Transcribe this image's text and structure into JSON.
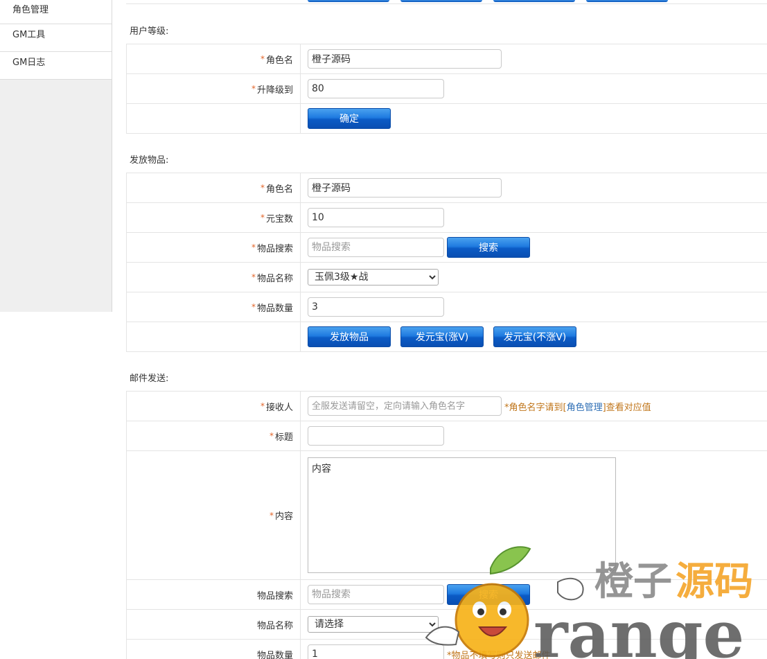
{
  "sidebar": {
    "items": [
      {
        "label": "角色管理"
      },
      {
        "label": "GM工具"
      },
      {
        "label": "GM日志"
      }
    ]
  },
  "level": {
    "title": "用户等级:",
    "role_label": "角色名",
    "role_value": "橙子源码",
    "level_label": "升降级到",
    "level_value": "80",
    "confirm": "确定"
  },
  "items": {
    "title": "发放物品:",
    "role_label": "角色名",
    "role_value": "橙子源码",
    "yuanbao_label": "元宝数",
    "yuanbao_value": "10",
    "search_label": "物品搜索",
    "search_placeholder": "物品搜索",
    "search_btn": "搜索",
    "name_label": "物品名称",
    "name_selected": "玉佩3级★战",
    "qty_label": "物品数量",
    "qty_value": "3",
    "send_btn": "发放物品",
    "yuanbao_v_btn": "发元宝(涨V)",
    "yuanbao_nov_btn": "发元宝(不涨V)"
  },
  "mail": {
    "title": "邮件发送:",
    "receiver_label": "接收人",
    "receiver_placeholder": "全服发送请留空，定向请输入角色名字",
    "receiver_hint_a": "*角色名字请到[",
    "receiver_hint_link": "角色管理",
    "receiver_hint_b": "]查看对应值",
    "subject_label": "标题",
    "subject_value": "",
    "content_label": "内容",
    "content_value": "内容",
    "search_label": "物品搜索",
    "search_placeholder": "物品搜索",
    "search_btn": "搜索",
    "name_label": "物品名称",
    "name_selected": "请选择",
    "qty_label": "物品数量",
    "qty_value": "1",
    "qty_hint": "*物品不填写则只发送邮件"
  },
  "watermark": {
    "cn": "橙子源码",
    "en": "range"
  },
  "colors": {
    "button_blue": "#1f7be0",
    "required_star": "#e3662b",
    "hint_orange": "#c0751a",
    "link_blue": "#2f6fb5"
  }
}
